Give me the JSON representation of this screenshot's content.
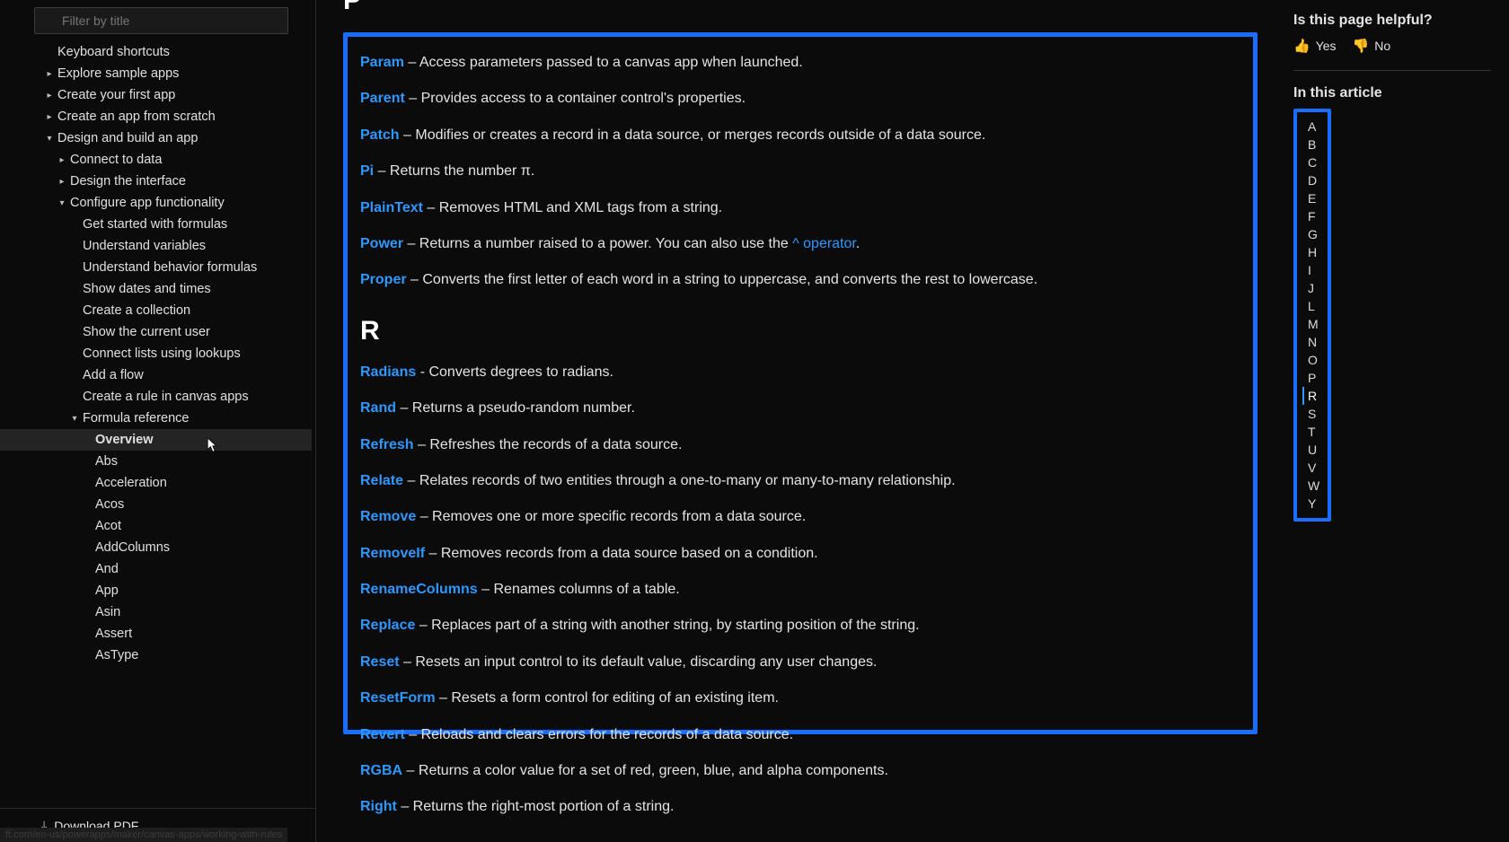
{
  "sidebar": {
    "filter_placeholder": "Filter by title",
    "items": [
      {
        "label": "Keyboard shortcuts",
        "indent": 64,
        "caret": ""
      },
      {
        "label": "Explore sample apps",
        "indent": 64,
        "caret": ">"
      },
      {
        "label": "Create your first app",
        "indent": 64,
        "caret": ">"
      },
      {
        "label": "Create an app from scratch",
        "indent": 64,
        "caret": ">"
      },
      {
        "label": "Design and build an app",
        "indent": 64,
        "caret": "v"
      },
      {
        "label": "Connect to data",
        "indent": 78,
        "caret": ">"
      },
      {
        "label": "Design the interface",
        "indent": 78,
        "caret": ">"
      },
      {
        "label": "Configure app functionality",
        "indent": 78,
        "caret": "v"
      },
      {
        "label": "Get started with formulas",
        "indent": 92,
        "caret": ""
      },
      {
        "label": "Understand variables",
        "indent": 92,
        "caret": ""
      },
      {
        "label": "Understand behavior formulas",
        "indent": 92,
        "caret": ""
      },
      {
        "label": "Show dates and times",
        "indent": 92,
        "caret": ""
      },
      {
        "label": "Create a collection",
        "indent": 92,
        "caret": ""
      },
      {
        "label": "Show the current user",
        "indent": 92,
        "caret": ""
      },
      {
        "label": "Connect lists using lookups",
        "indent": 92,
        "caret": ""
      },
      {
        "label": "Add a flow",
        "indent": 92,
        "caret": ""
      },
      {
        "label": "Create a rule in canvas apps",
        "indent": 92,
        "caret": ""
      },
      {
        "label": "Formula reference",
        "indent": 92,
        "caret": "v"
      },
      {
        "label": "Overview",
        "indent": 106,
        "caret": "",
        "active": true,
        "hover": true
      },
      {
        "label": "Abs",
        "indent": 106,
        "caret": ""
      },
      {
        "label": "Acceleration",
        "indent": 106,
        "caret": ""
      },
      {
        "label": "Acos",
        "indent": 106,
        "caret": ""
      },
      {
        "label": "Acot",
        "indent": 106,
        "caret": ""
      },
      {
        "label": "AddColumns",
        "indent": 106,
        "caret": ""
      },
      {
        "label": "And",
        "indent": 106,
        "caret": ""
      },
      {
        "label": "App",
        "indent": 106,
        "caret": ""
      },
      {
        "label": "Asin",
        "indent": 106,
        "caret": ""
      },
      {
        "label": "Assert",
        "indent": 106,
        "caret": ""
      },
      {
        "label": "AsType",
        "indent": 106,
        "caret": ""
      }
    ],
    "download_label": "Download PDF"
  },
  "main": {
    "section_P": "P",
    "p_items": [
      {
        "name": "Param",
        "desc": " – Access parameters passed to a canvas app when launched."
      },
      {
        "name": "Parent",
        "desc": " – Provides access to a container control's properties."
      },
      {
        "name": "Patch",
        "desc": " – Modifies or creates a record in a data source, or merges records outside of a data source."
      },
      {
        "name": "Pi",
        "desc": " – Returns the number π."
      },
      {
        "name": "PlainText",
        "desc": " – Removes HTML and XML tags from a string."
      },
      {
        "name": "Power",
        "desc": " – Returns a number raised to a power. You can also use the ",
        "link2": "^ operator",
        "post": "."
      },
      {
        "name": "Proper",
        "desc": " – Converts the first letter of each word in a string to uppercase, and converts the rest to lowercase."
      }
    ],
    "section_R": "R",
    "r_items": [
      {
        "name": "Radians",
        "desc": " - Converts degrees to radians."
      },
      {
        "name": "Rand",
        "desc": " – Returns a pseudo-random number."
      },
      {
        "name": "Refresh",
        "desc": " – Refreshes the records of a data source."
      },
      {
        "name": "Relate",
        "desc": " – Relates records of two entities through a one-to-many or many-to-many relationship."
      },
      {
        "name": "Remove",
        "desc": " – Removes one or more specific records from a data source."
      },
      {
        "name": "RemoveIf",
        "desc": " – Removes records from a data source based on a condition."
      },
      {
        "name": "RenameColumns",
        "desc": " – Renames columns of a table."
      },
      {
        "name": "Replace",
        "desc": " – Replaces part of a string with another string, by starting position of the string."
      },
      {
        "name": "Reset",
        "desc": " – Resets an input control to its default value, discarding any user changes."
      },
      {
        "name": "ResetForm",
        "desc": " – Resets a form control for editing of an existing item."
      },
      {
        "name": "Revert",
        "desc": " – Reloads and clears errors for the records of a data source."
      },
      {
        "name": "RGBA",
        "desc": " – Returns a color value for a set of red, green, blue, and alpha components."
      },
      {
        "name": "Right",
        "desc": " – Returns the right-most portion of a string."
      }
    ]
  },
  "right": {
    "helpful": "Is this page helpful?",
    "yes": "Yes",
    "no": "No",
    "in_article": "In this article",
    "toc": [
      "A",
      "B",
      "C",
      "D",
      "E",
      "F",
      "G",
      "H",
      "I",
      "J",
      "L",
      "M",
      "N",
      "O",
      "P",
      "R",
      "S",
      "T",
      "U",
      "V",
      "W",
      "Y"
    ],
    "current": "R"
  },
  "status_url": "ft.com/en-us/powerapps/maker/canvas-apps/working-with-rules"
}
